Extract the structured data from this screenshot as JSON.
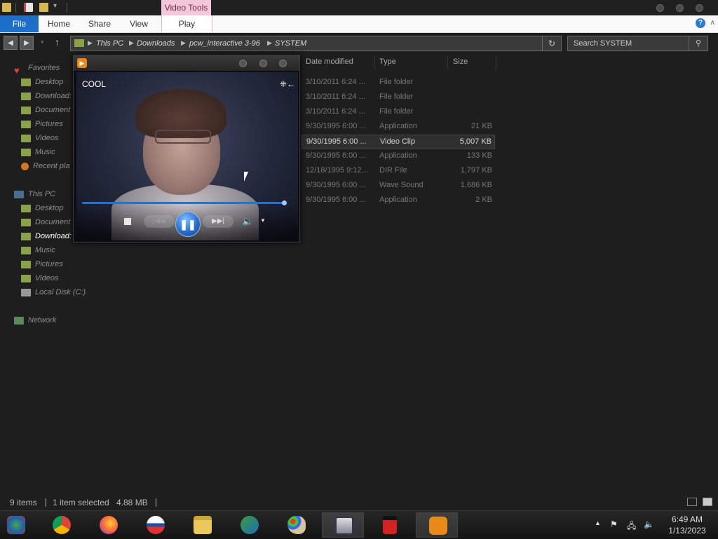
{
  "title_bar": {
    "contextual_tab": "Video Tools"
  },
  "ribbon": {
    "tabs": [
      "File",
      "Home",
      "Share",
      "View",
      "Play"
    ]
  },
  "address_bar": {
    "path": [
      "This PC",
      "Downloads",
      "pcw_interactive 3-96",
      "SYSTEM"
    ],
    "search_placeholder": "Search SYSTEM"
  },
  "nav_pane": {
    "favorites_label": "Favorites",
    "favorites": [
      "Desktop",
      "Download:",
      "Document",
      "Pictures",
      "Videos",
      "Music",
      "Recent pla"
    ],
    "this_pc_label": "This PC",
    "this_pc": [
      "Desktop",
      "Document",
      "Download:",
      "Music",
      "Pictures",
      "Videos",
      "Local Disk (C:)"
    ],
    "network_label": "Network"
  },
  "file_list": {
    "columns": [
      "Date modified",
      "Type",
      "Size"
    ],
    "rows": [
      {
        "date": "3/10/2011 6:24 ...",
        "type": "File folder",
        "size": ""
      },
      {
        "date": "3/10/2011 6:24 ...",
        "type": "File folder",
        "size": ""
      },
      {
        "date": "3/10/2011 6:24 ...",
        "type": "File folder",
        "size": ""
      },
      {
        "date": "9/30/1995 6:00 ...",
        "type": "Application",
        "size": "21 KB"
      },
      {
        "date": "9/30/1995 6:00 ...",
        "type": "Video Clip",
        "size": "5,007 KB",
        "selected": true
      },
      {
        "date": "9/30/1995 6:00 ...",
        "type": "Application",
        "size": "133 KB"
      },
      {
        "date": "12/18/1995 9:12...",
        "type": "DIR File",
        "size": "1,797 KB"
      },
      {
        "date": "9/30/1995 6:00 ...",
        "type": "Wave Sound",
        "size": "1,686 KB"
      },
      {
        "date": "9/30/1995 6:00 ...",
        "type": "Application",
        "size": "2 KB"
      }
    ]
  },
  "media_player": {
    "video_caption": "COOL",
    "progress": 0.99
  },
  "status_bar": {
    "item_count": "9 items",
    "selection": "1 item selected",
    "selection_size": "4.88 MB"
  },
  "taskbar": {
    "apps": [
      "windows-media-center-icon",
      "chrome-icon",
      "firefox-icon",
      "obama-logo-icon",
      "file-explorer-icon",
      "network-app-icon",
      "paint-icon",
      "multi-window-app-icon",
      "red-app-icon",
      "media-player-icon"
    ],
    "time": "6:49 AM",
    "date": "1/13/2023"
  },
  "colors": {
    "accent": "#1e6fc7",
    "video_tools": "#f4c6d9",
    "background": "#1e1e1e"
  }
}
